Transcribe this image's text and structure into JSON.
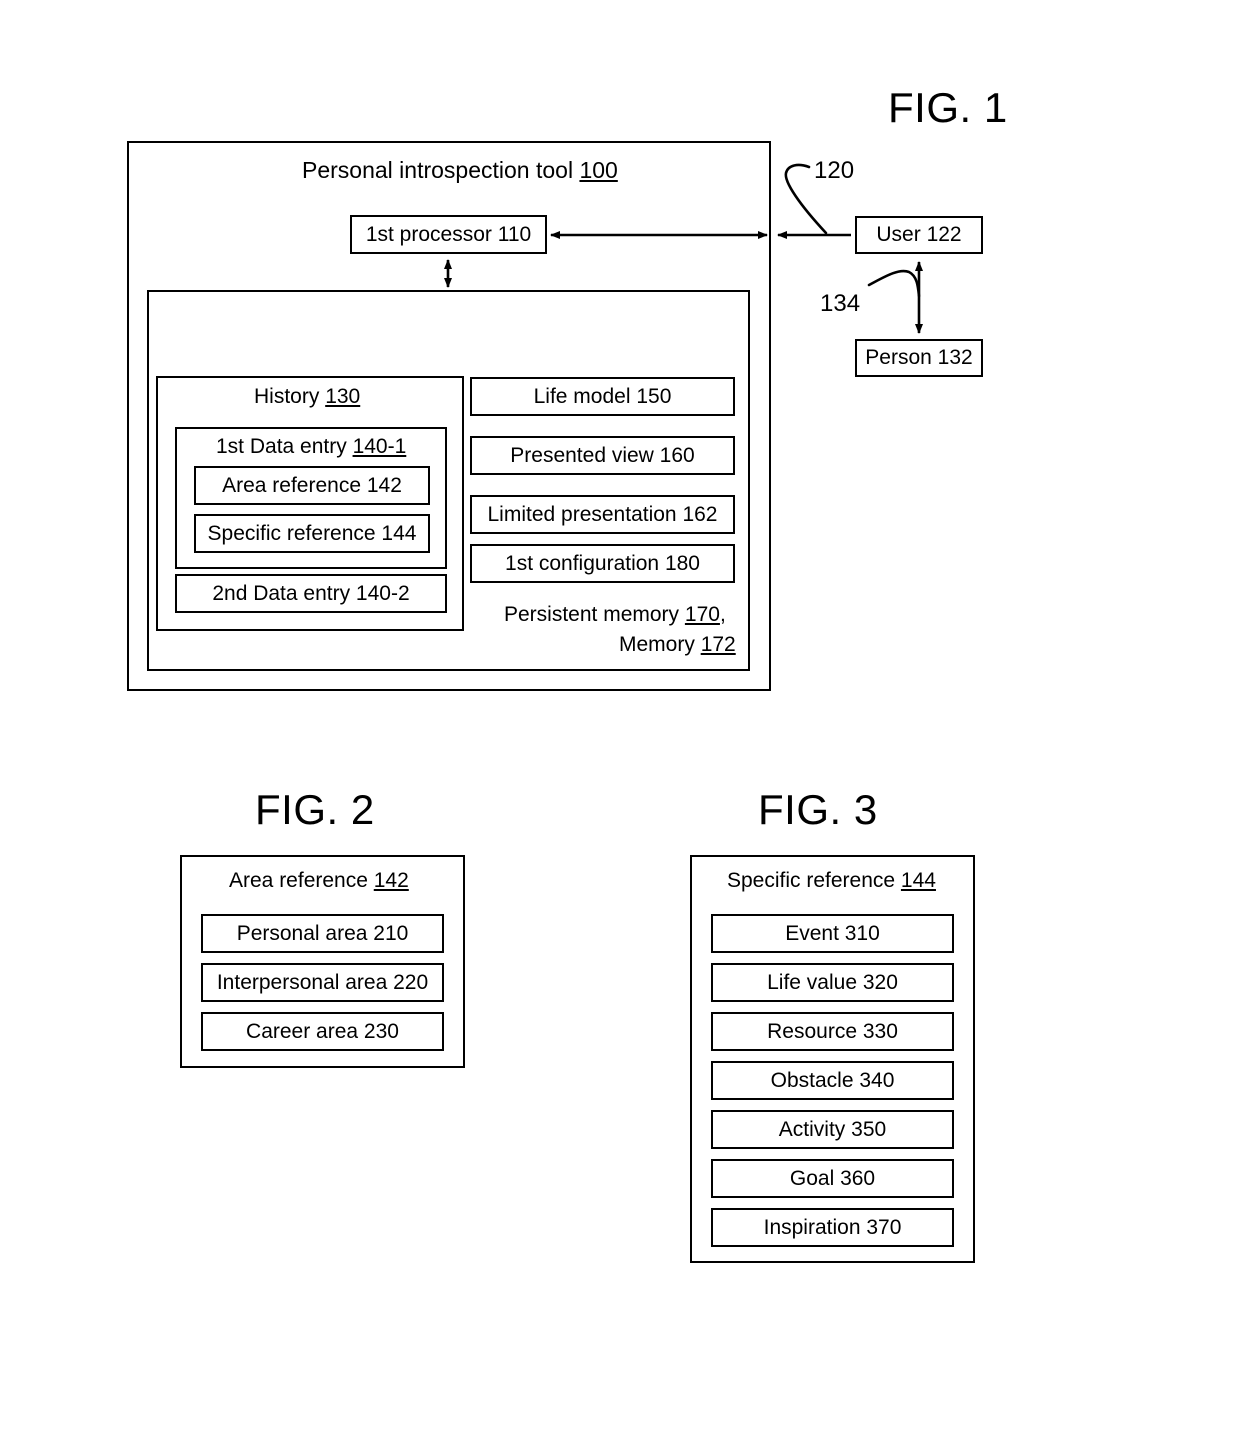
{
  "figures": {
    "fig1": {
      "title": "FIG. 1",
      "outer_box_label_prefix": "Personal introspection tool ",
      "outer_box_label_num": "100",
      "processor": "1st processor 110",
      "user": "User 122",
      "person": "Person 132",
      "leader_120": "120",
      "leader_134": "134",
      "history_prefix": "History ",
      "history_num": "130",
      "data_entry_1_prefix": "1st Data entry ",
      "data_entry_1_num": "140-1",
      "area_reference_142": "Area reference 142",
      "specific_reference_144": "Specific reference 144",
      "data_entry_2": "2nd Data entry 140-2",
      "life_model": "Life model 150",
      "presented_view": "Presented view 160",
      "limited_presentation": "Limited presentation 162",
      "first_configuration": "1st configuration 180",
      "memory_line1_prefix": "Persistent memory ",
      "memory_line1_num": "170",
      "memory_line1_suffix": ",",
      "memory_line2_prefix": "Memory ",
      "memory_line2_num": "172"
    },
    "fig2": {
      "title": "FIG. 2",
      "header_prefix": "Area reference ",
      "header_num": "142",
      "items": [
        "Personal area 210",
        "Interpersonal area 220",
        "Career area 230"
      ]
    },
    "fig3": {
      "title": "FIG. 3",
      "header_prefix": "Specific reference ",
      "header_num": "144",
      "items": [
        "Event 310",
        "Life value 320",
        "Resource 330",
        "Obstacle 340",
        "Activity 350",
        "Goal 360",
        "Inspiration 370"
      ]
    }
  },
  "colors": {
    "ink": "#000000",
    "paper": "#ffffff"
  }
}
